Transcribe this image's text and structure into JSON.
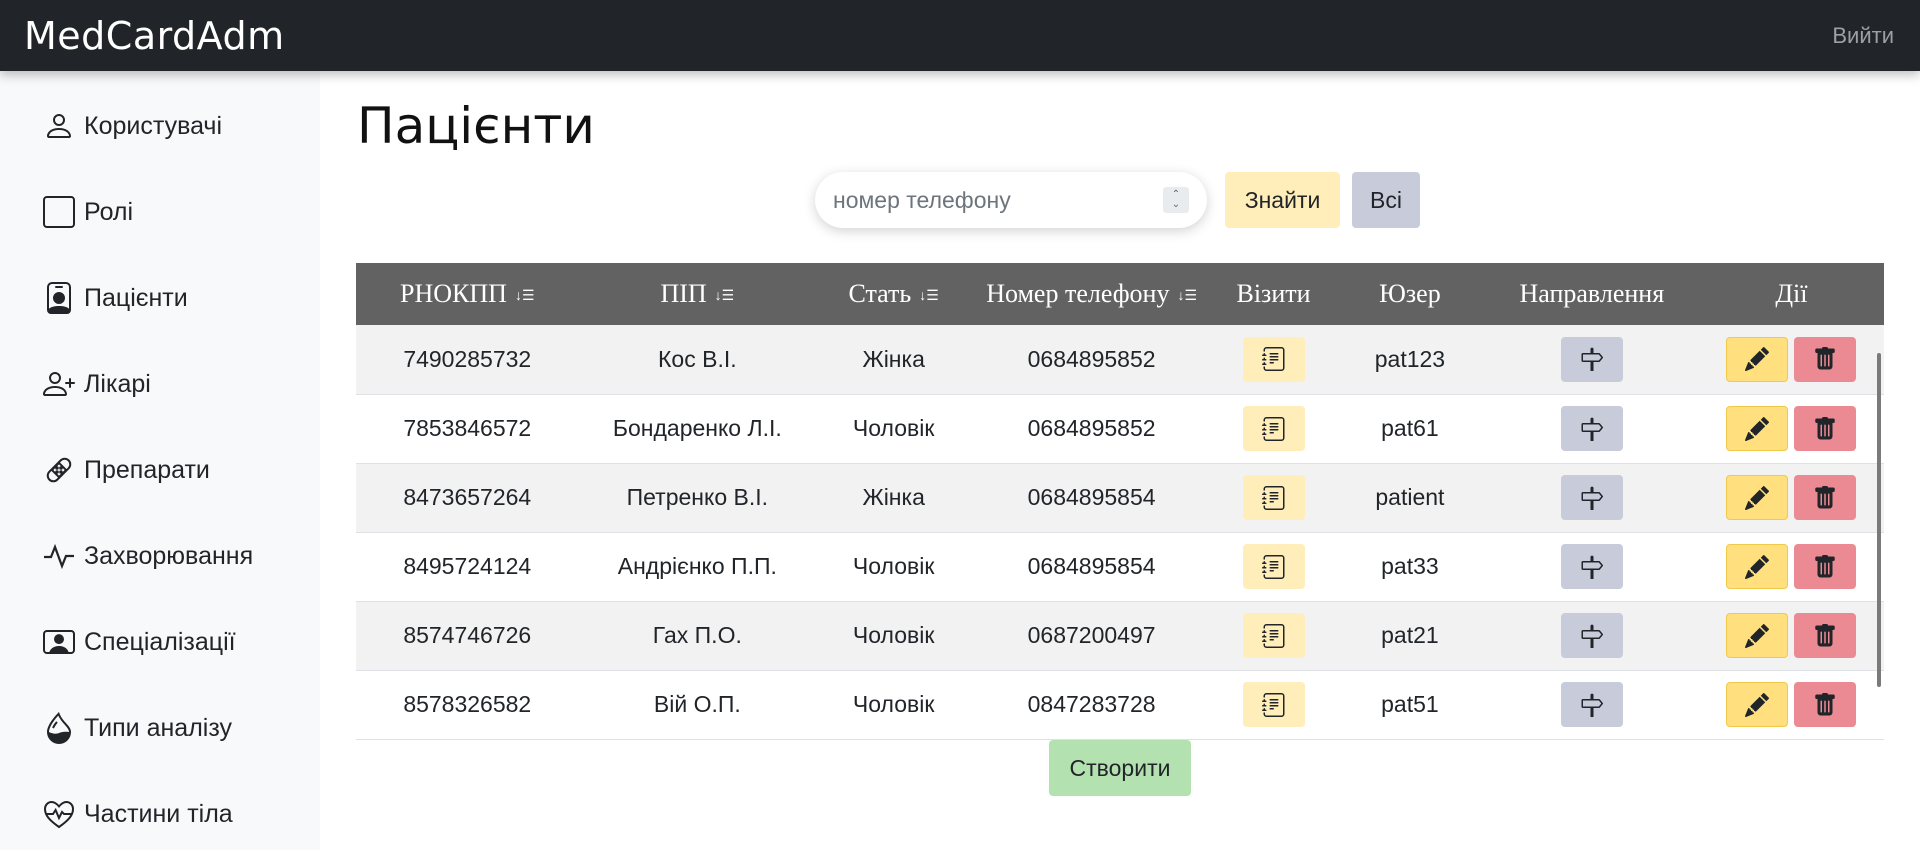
{
  "navbar": {
    "brand": "MedCardAdm",
    "logout_label": "Вийти"
  },
  "sidebar": {
    "items": [
      {
        "label": "Користувачі",
        "icon": "person-icon"
      },
      {
        "label": "Ролі",
        "icon": "square-icon"
      },
      {
        "label": "Пацієнти",
        "icon": "person-badge-icon"
      },
      {
        "label": "Лікарі",
        "icon": "person-plus-icon"
      },
      {
        "label": "Препарати",
        "icon": "bandage-icon"
      },
      {
        "label": "Захворювання",
        "icon": "activity-icon"
      },
      {
        "label": "Спеціалізації",
        "icon": "person-video-icon"
      },
      {
        "label": "Типи аналізу",
        "icon": "droplet-half-icon"
      },
      {
        "label": "Частини тіла",
        "icon": "heart-pulse-icon"
      }
    ]
  },
  "main": {
    "title": "Пацієнти",
    "search": {
      "placeholder": "номер телефону",
      "find_label": "Знайти",
      "all_label": "Всі"
    },
    "table": {
      "columns": [
        "РНОКПП",
        "ПІП",
        "Стать",
        "Номер телефону",
        "Візити",
        "Юзер",
        "Направлення",
        "Дії"
      ],
      "rows": [
        {
          "rnokpp": "7490285732",
          "pip": "Кос В.І.",
          "gender": "Жінка",
          "phone": "0684895852",
          "user": "pat123"
        },
        {
          "rnokpp": "7853846572",
          "pip": "Бондаренко Л.І.",
          "gender": "Чоловік",
          "phone": "0684895852",
          "user": "pat61"
        },
        {
          "rnokpp": "8473657264",
          "pip": "Петренко В.І.",
          "gender": "Жінка",
          "phone": "0684895854",
          "user": "patient"
        },
        {
          "rnokpp": "8495724124",
          "pip": "Андрієнко П.П.",
          "gender": "Чоловік",
          "phone": "0684895854",
          "user": "pat33"
        },
        {
          "rnokpp": "8574746726",
          "pip": "Гах П.О.",
          "gender": "Чоловік",
          "phone": "0687200497",
          "user": "pat21"
        },
        {
          "rnokpp": "8578326582",
          "pip": "Вій О.П.",
          "gender": "Чоловік",
          "phone": "0847283728",
          "user": "pat51"
        }
      ]
    },
    "create_label": "Створити"
  },
  "colors": {
    "navbar": "#212529",
    "table_header": "#626262",
    "visit_button": "#ffeeba",
    "direction_button": "#c8ccda",
    "edit_button": "#ffdf7e",
    "delete_button": "#ec8a93",
    "create_button": "#b3e2b0"
  }
}
